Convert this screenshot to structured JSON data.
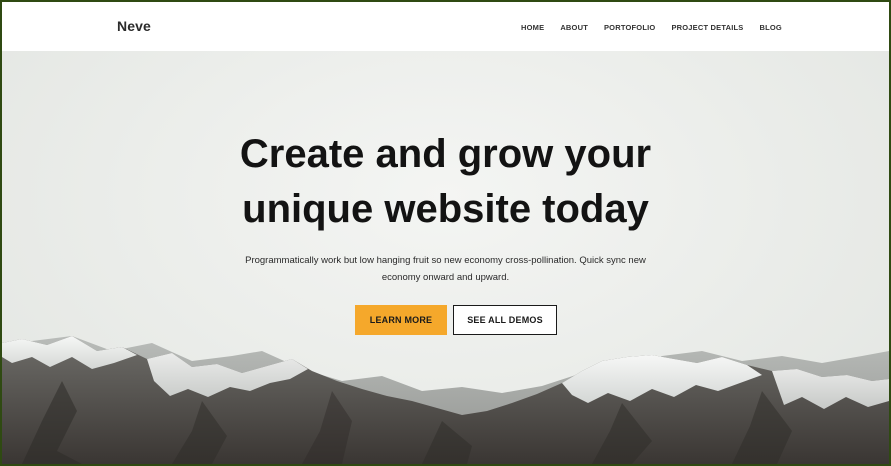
{
  "header": {
    "logo": "Neve",
    "nav": [
      "HOME",
      "ABOUT",
      "PORTOFOLIO",
      "PROJECT DETAILS",
      "BLOG"
    ]
  },
  "hero": {
    "headline_line1": "Create and grow your",
    "headline_line2": "unique website today",
    "subtext_line1": "Programmatically work but low hanging fruit so new economy cross-pollination. Quick sync new",
    "subtext_line2": "economy onward and upward.",
    "primary_button": "LEARN MORE",
    "secondary_button": "SEE ALL DEMOS"
  },
  "colors": {
    "accent": "#f5a82b",
    "frame_border": "#2f4a12",
    "text_dark": "#131313"
  }
}
